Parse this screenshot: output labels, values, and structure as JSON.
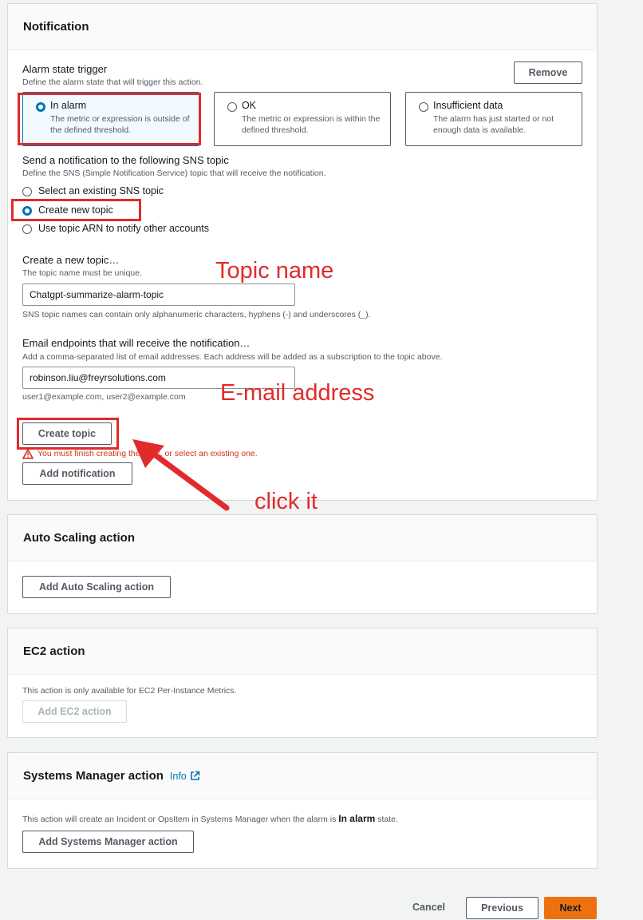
{
  "notification": {
    "title": "Notification",
    "alarm_trigger_label": "Alarm state trigger",
    "alarm_trigger_desc": "Define the alarm state that will trigger this action.",
    "remove_label": "Remove",
    "states": [
      {
        "title": "In alarm",
        "desc": "The metric or expression is outside of the defined threshold.",
        "selected": true
      },
      {
        "title": "OK",
        "desc": "The metric or expression is within the defined threshold.",
        "selected": false
      },
      {
        "title": "Insufficient data",
        "desc": "The alarm has just started or not enough data is available.",
        "selected": false
      }
    ],
    "sns_label": "Send a notification to the following SNS topic",
    "sns_desc": "Define the SNS (Simple Notification Service) topic that will receive the notification.",
    "sns_options": [
      {
        "label": "Select an existing SNS topic",
        "selected": false
      },
      {
        "label": "Create new topic",
        "selected": true
      },
      {
        "label": "Use topic ARN to notify other accounts",
        "selected": false
      }
    ],
    "new_topic_label": "Create a new topic…",
    "new_topic_desc": "The topic name must be unique.",
    "topic_name_value": "Chatgpt-summarize-alarm-topic",
    "topic_name_hint": "SNS topic names can contain only alphanumeric characters, hyphens (-) and underscores (_).",
    "email_label": "Email endpoints that will receive the notification…",
    "email_desc": "Add a comma-separated list of email addresses. Each address will be added as a subscription to the topic above.",
    "email_value": "robinson.liu@freyrsolutions.com",
    "email_hint": "user1@example.com, user2@example.com",
    "create_topic_label": "Create topic",
    "warning_text": "You must finish creating the topic, or select an existing one.",
    "add_notification_label": "Add notification"
  },
  "autoscaling": {
    "title": "Auto Scaling action",
    "button_label": "Add Auto Scaling action"
  },
  "ec2": {
    "title": "EC2 action",
    "desc": "This action is only available for EC2 Per-Instance Metrics.",
    "button_label": "Add EC2 action"
  },
  "ssm": {
    "title": "Systems Manager action",
    "info_label": "Info",
    "desc_prefix": "This action will create an Incident or OpsItem in Systems Manager when the alarm is",
    "desc_bold": "In alarm",
    "desc_suffix": "state.",
    "button_label": "Add Systems Manager action"
  },
  "footer": {
    "cancel_label": "Cancel",
    "previous_label": "Previous",
    "next_label": "Next"
  },
  "annotations": {
    "topic_name": "Topic name",
    "email_address": "E-mail address",
    "click_it": "click it"
  },
  "colors": {
    "annotation_red": "#e12b2b",
    "accent_blue": "#0073bb",
    "primary_orange": "#ec7211"
  },
  "icons": {
    "warning": "warning-triangle-icon",
    "external_link": "external-link-icon",
    "arrow": "red-arrow-icon"
  }
}
